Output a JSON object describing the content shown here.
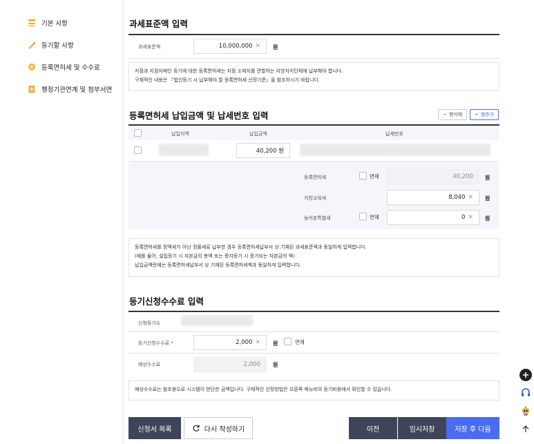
{
  "sidebar": {
    "items": [
      {
        "label": "기본 사항"
      },
      {
        "label": "등기할 사항"
      },
      {
        "label": "등록면허세 및 수수료"
      },
      {
        "label": "행정기관연계 및 첨부서면"
      }
    ]
  },
  "tax_base": {
    "title": "과세표준액 입력",
    "field_label": "과세표준액",
    "value": "10,000,000",
    "unit": "원",
    "notice_line1": "지점과 지점지배인 등기에 대한 등록면허세는 지점 소재지를 관할하는 지방자치단체에 납부해야 합니다.",
    "notice_line2": "구체적인 내용은 『법인등기 시 납부해야 할 등록면허세 산정기준』을 참조하시기 바랍니다."
  },
  "reg_tax": {
    "title": "등록면허세 납입금액 및 납세번호 입력",
    "delete_row_label": "행삭제",
    "add_row_label": "행추가",
    "columns": [
      "납입지역",
      "납입금액",
      "납세번호"
    ],
    "row_amount": "40,200 원",
    "details": [
      {
        "label": "등록면허세",
        "exempt_label": "면제",
        "value": "40,200",
        "unit": "원"
      },
      {
        "label": "지방교육세",
        "value": "8,040",
        "unit": "원"
      },
      {
        "label": "농어촌특별세",
        "exempt_label": "면제",
        "value": "0",
        "unit": "원"
      }
    ],
    "notice_line1": "등록면허세를 정액세가 아닌 정률세로 납부한 경우 등록면허세납부서 상 기재된 과세표준액과 동일하게 입력합니다.",
    "notice_line2": "(예를 들어, 설립등기 시 자본금의 총액 또는 증자등기 시 증가되는 자본금의 액)",
    "notice_line3": "납입금액란에는 등록면허세납부서 상 기재된 등록면허세액과 동일하게 입력합니다."
  },
  "fee": {
    "title": "등기신청수수료 입력",
    "office_label": "신청등기소",
    "fee_label": "등기신청수수료",
    "required_mark": "*",
    "fee_value": "2,000",
    "fee_unit": "원",
    "exempt_label": "면제",
    "expected_label": "예상수수료",
    "expected_value": "2,000",
    "expected_unit": "원",
    "notice": "예상수수료는 참조용으로 시스템이 판단한 금액입니다. 구체적인 산정방법은 오른쪽 메뉴바의 등기비용에서 확인할 수 있습니다."
  },
  "footer": {
    "list_label": "신청서 목록",
    "rewrite_label": "다시 작성하기",
    "prev_label": "이전",
    "temp_save_label": "임시저장",
    "save_next_label": "저장 후 다음"
  },
  "colors": {
    "accent": "#4a6cf0",
    "dark_button": "#3f4559"
  },
  "icons": [
    "list-icon",
    "pencil-icon",
    "coin-icon",
    "document-plus-icon",
    "refresh-icon",
    "plus-circle-icon",
    "headset-icon",
    "robot-icon",
    "arrow-up-icon",
    "close-icon"
  ]
}
